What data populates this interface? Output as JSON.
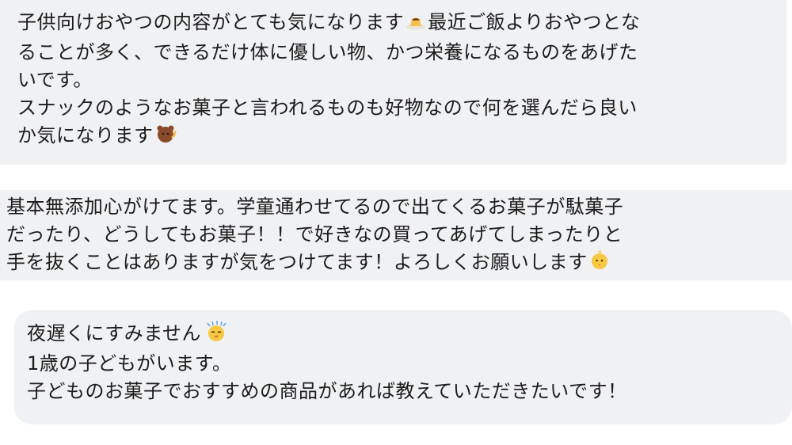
{
  "messages": [
    {
      "lines": [
        "子供向けおやつの内容がとても気になります",
        "最近ご飯よりおやつとな",
        "ることが多く、できるだけ体に優しい物、かつ栄養になるものをあげた",
        "いです。",
        "スナックのようなお菓子と言われるものも好物なので何を選んだら良い",
        "か気になります"
      ],
      "emojis": [
        "pudding-emoji",
        "thinking-bear-emoji"
      ]
    },
    {
      "lines": [
        "基本無添加心がけてます。学童通わせてるので出てくるお菓子が駄菓子",
        "だったり、どうしてもお菓子！！で好きなの買ってあげてしまったりと",
        "手を抜くことはありますが気をつけてます！よろしくお願いします"
      ],
      "emojis": [
        "winking-chick-emoji"
      ]
    },
    {
      "lines": [
        "夜遅くにすみません",
        "1歳の子どもがいます。",
        "子どものお菓子でおすすめの商品があれば教えていただきたいです！"
      ],
      "emojis": [
        "sweating-chick-emoji"
      ]
    }
  ]
}
